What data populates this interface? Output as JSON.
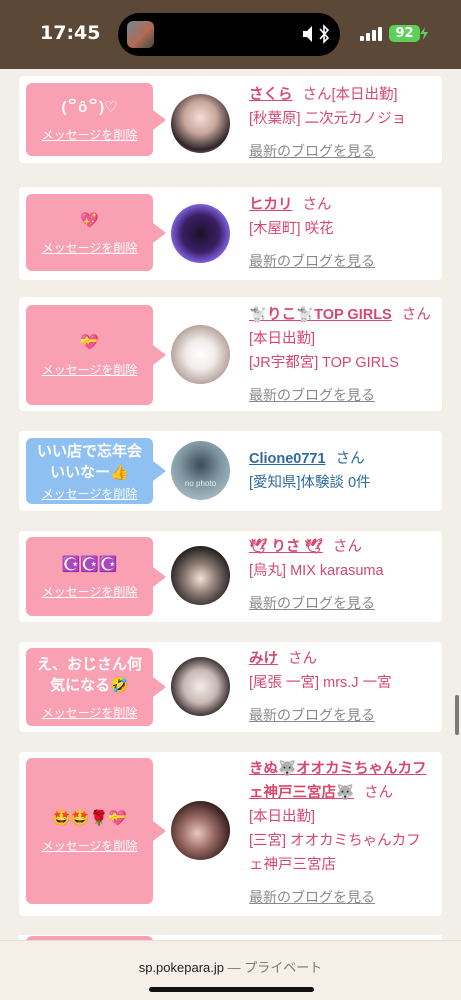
{
  "status_bar": {
    "time": "17:45",
    "battery": "92"
  },
  "cards": [
    {
      "message": "(꒪ȏ꒪)♡",
      "delete_label": "メッセージを削除",
      "name": "さくら",
      "suffix": "さん",
      "lines": [
        "[本日出勤]",
        "[秋葉原] 二次元カノジョ"
      ],
      "blog_link": "最新のブログを見る"
    },
    {
      "message": "💖",
      "delete_label": "メッセージを削除",
      "name": "ヒカリ",
      "suffix": "さん",
      "lines": [
        "[木屋町] 咲花"
      ],
      "blog_link": "最新のブログを見る"
    },
    {
      "message": "💝",
      "delete_label": "メッセージを削除",
      "name": "🐩りこ🐩TOP GIRLS",
      "suffix": "さん",
      "lines": [
        "[本日出勤]",
        "[JR宇都宮] TOP GIRLS"
      ],
      "blog_link": "最新のブログを見る"
    },
    {
      "message": "いい店で忘年会いいなー👍",
      "delete_label": "メッセージを削除",
      "name": "Clione0771",
      "suffix": "さん",
      "lines": [
        "[愛知県]体験談 0件"
      ],
      "blog_link": "",
      "avatar_text": "no photo"
    },
    {
      "message": "☪️☪️☪️",
      "delete_label": "メッセージを削除",
      "name": "🕊 りさ 🕊",
      "suffix": "さん",
      "lines": [
        "[烏丸] MIX karasuma"
      ],
      "blog_link": "最新のブログを見る"
    },
    {
      "message": "え、おじさん何気になる🤣",
      "delete_label": "メッセージを削除",
      "name": "みけ",
      "suffix": "さん",
      "lines": [
        "[尾張 一宮] mrs.J 一宮"
      ],
      "blog_link": "最新のブログを見る"
    },
    {
      "message": "🤩🤩🌹💝",
      "delete_label": "メッセージを削除",
      "name": "きぬ🐺オオカミちゃんカフェ神戸三宮店🐺",
      "suffix": "さん",
      "lines": [
        "[本日出勤]",
        "[三宮] オオカミちゃんカフェ神戸三宮店"
      ],
      "blog_link": "最新のブログを見る"
    }
  ],
  "browser_bar": {
    "domain": "sp.pokepara.jp",
    "separator": "—",
    "mode": "プライベート"
  },
  "colors": {
    "accent_pink": "#d9476e",
    "bubble_pink": "#f9a0b3",
    "bubble_blue": "#8fc0f2",
    "link_blue": "#2c6aa0"
  }
}
